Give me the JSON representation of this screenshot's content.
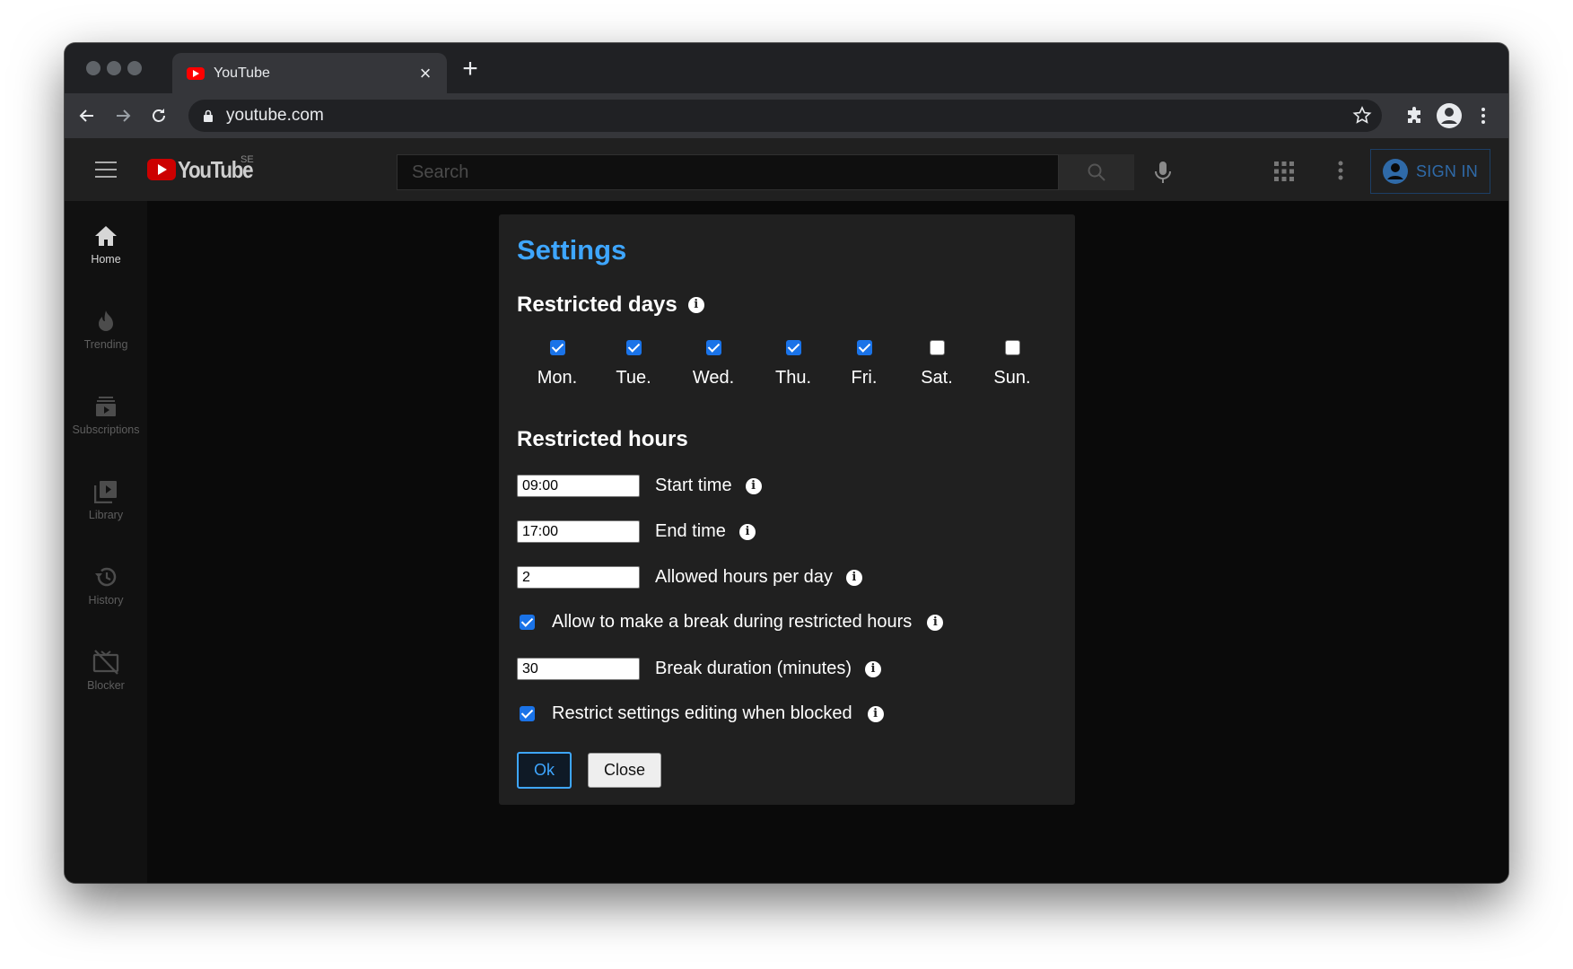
{
  "browser": {
    "tab_title": "YouTube",
    "tab_close": "×",
    "new_tab": "+",
    "url": "youtube.com"
  },
  "youtube": {
    "logo_text": "YouTube",
    "region": "SE",
    "search_placeholder": "Search",
    "sign_in": "SIGN IN",
    "sidebar": [
      {
        "label": "Home",
        "icon": "home-icon"
      },
      {
        "label": "Trending",
        "icon": "trending-icon"
      },
      {
        "label": "Subscriptions",
        "icon": "subscriptions-icon"
      },
      {
        "label": "Library",
        "icon": "library-icon"
      },
      {
        "label": "History",
        "icon": "history-icon"
      },
      {
        "label": "Blocker",
        "icon": "blocker-icon"
      }
    ]
  },
  "settings": {
    "title": "Settings",
    "restricted_days": {
      "title": "Restricted days",
      "days": [
        {
          "label": "Mon.",
          "checked": true
        },
        {
          "label": "Tue.",
          "checked": true
        },
        {
          "label": "Wed.",
          "checked": true
        },
        {
          "label": "Thu.",
          "checked": true
        },
        {
          "label": "Fri.",
          "checked": true
        },
        {
          "label": "Sat.",
          "checked": false
        },
        {
          "label": "Sun.",
          "checked": false
        }
      ]
    },
    "restricted_hours": {
      "title": "Restricted hours",
      "start_time": {
        "value": "09:00",
        "label": "Start time"
      },
      "end_time": {
        "value": "17:00",
        "label": "End time"
      },
      "allowed_hours": {
        "value": "2",
        "label": "Allowed hours per day"
      },
      "allow_break": {
        "checked": true,
        "label": "Allow to make a break during restricted hours"
      },
      "break_duration": {
        "value": "30",
        "label": "Break duration (minutes)"
      },
      "restrict_editing": {
        "checked": true,
        "label": "Restrict settings editing when blocked"
      }
    },
    "ok_label": "Ok",
    "close_label": "Close"
  },
  "colors": {
    "accent": "#3ea6ff",
    "checkbox_blue": "#1a73e8",
    "youtube_red": "#ff0000"
  }
}
